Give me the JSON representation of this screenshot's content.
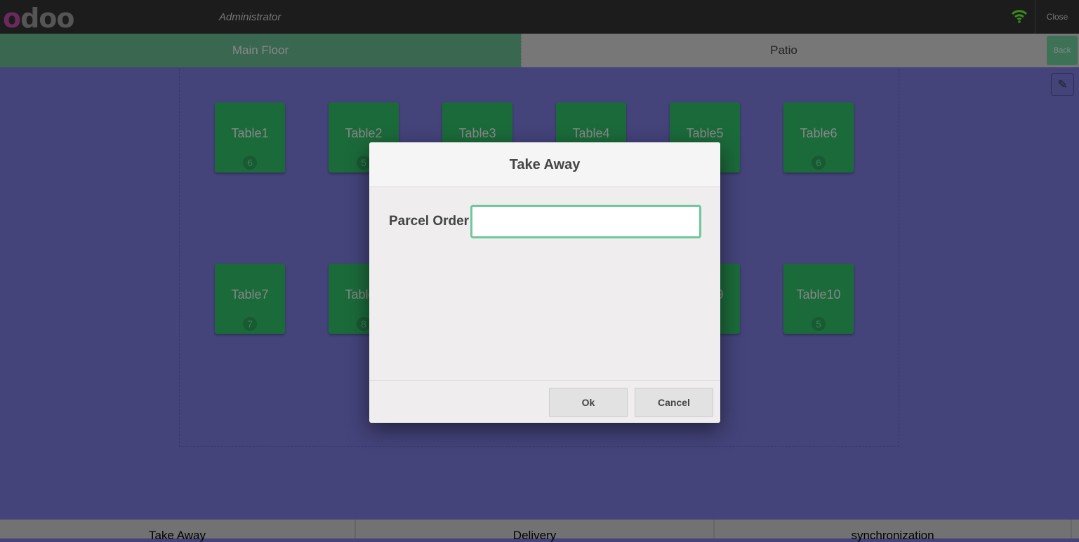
{
  "header": {
    "logo": "odoo",
    "user": "Administrator",
    "close_label": "Close",
    "status_icon": "wifi-icon",
    "status_color": "#3c8a1c"
  },
  "floors": [
    {
      "label": "Main Floor",
      "active": true
    },
    {
      "label": "Patio",
      "active": false
    }
  ],
  "back_label": "Back",
  "tables": [
    {
      "name": "Table1",
      "seats": "6"
    },
    {
      "name": "Table2",
      "seats": "5"
    },
    {
      "name": "Table3",
      "seats": ""
    },
    {
      "name": "Table4",
      "seats": ""
    },
    {
      "name": "Table5",
      "seats": ""
    },
    {
      "name": "Table6",
      "seats": "6"
    },
    {
      "name": "Table7",
      "seats": "7"
    },
    {
      "name": "Table8",
      "seats": "8"
    },
    {
      "name": "Table9",
      "seats": ""
    },
    {
      "name": "Table10",
      "seats": "5"
    }
  ],
  "bottom_buttons": [
    "Take Away",
    "Delivery",
    "synchronization"
  ],
  "dialog": {
    "title": "Take Away",
    "field_label": "Parcel Order",
    "field_value": "",
    "ok_label": "Ok",
    "cancel_label": "Cancel"
  }
}
